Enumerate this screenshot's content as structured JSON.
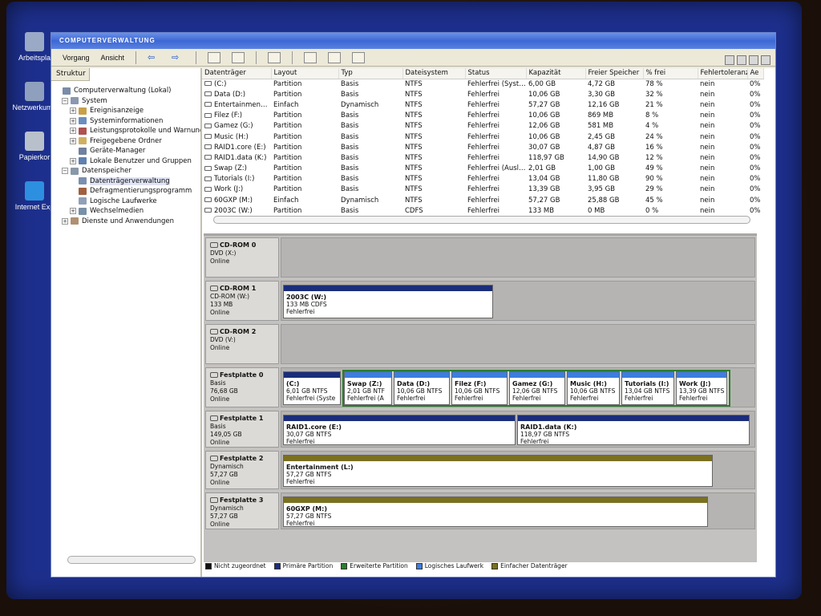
{
  "colors": {
    "primary": "#1a2d7a",
    "extended": "#2e7d2e",
    "logical": "#3c7ee0",
    "simple": "#7a7020",
    "unallocated": "#111111"
  },
  "desktop": {
    "icons": [
      {
        "label": "Arbeitspla",
        "icon": "my-computer-icon"
      },
      {
        "label": "Netzwerkumg",
        "icon": "network-icon"
      },
      {
        "label": "Papierkor",
        "icon": "recycle-bin-icon"
      },
      {
        "label": "Internet Exp",
        "icon": "internet-explorer-icon"
      }
    ]
  },
  "window": {
    "title": "COMPUTERVERWALTUNG",
    "menu": {
      "action": "Vorgang",
      "view": "Ansicht"
    }
  },
  "tree": {
    "tab": "Struktur",
    "items": [
      {
        "label": "Computerverwaltung (Lokal)",
        "level": 0,
        "toggle": "",
        "icon": "computer-mgmt-icon"
      },
      {
        "label": "System",
        "level": 1,
        "toggle": "-",
        "icon": "system-tools-icon"
      },
      {
        "label": "Ereignisanzeige",
        "level": 2,
        "toggle": "+",
        "icon": "event-viewer-icon"
      },
      {
        "label": "Systeminformationen",
        "level": 2,
        "toggle": "+",
        "icon": "system-info-icon"
      },
      {
        "label": "Leistungsprotokolle und Warnung",
        "level": 2,
        "toggle": "+",
        "icon": "performance-logs-icon"
      },
      {
        "label": "Freigegebene Ordner",
        "level": 2,
        "toggle": "+",
        "icon": "shared-folders-icon"
      },
      {
        "label": "Geräte-Manager",
        "level": 2,
        "toggle": "",
        "icon": "device-manager-icon"
      },
      {
        "label": "Lokale Benutzer und Gruppen",
        "level": 2,
        "toggle": "+",
        "icon": "users-groups-icon"
      },
      {
        "label": "Datenspeicher",
        "level": 1,
        "toggle": "-",
        "icon": "storage-icon"
      },
      {
        "label": "Datenträgerverwaltung",
        "level": 2,
        "toggle": "",
        "icon": "disk-management-icon",
        "selected": true
      },
      {
        "label": "Defragmentierungsprogramm",
        "level": 2,
        "toggle": "",
        "icon": "defrag-icon"
      },
      {
        "label": "Logische Laufwerke",
        "level": 2,
        "toggle": "",
        "icon": "logical-drives-icon"
      },
      {
        "label": "Wechselmedien",
        "level": 2,
        "toggle": "+",
        "icon": "removable-media-icon"
      },
      {
        "label": "Dienste und Anwendungen",
        "level": 1,
        "toggle": "+",
        "icon": "services-icon"
      }
    ]
  },
  "volumes": {
    "columns": [
      "Datenträger",
      "Layout",
      "Typ",
      "Dateisystem",
      "Status",
      "Kapazität",
      "Freier Speicher",
      "% frei",
      "Fehlertoleranz",
      "Ae"
    ],
    "rows": [
      [
        "(C:)",
        "Partition",
        "Basis",
        "NTFS",
        "Fehlerfrei (Syst…",
        "6,00 GB",
        "4,72 GB",
        "78 %",
        "nein",
        "0%"
      ],
      [
        "Data (D:)",
        "Partition",
        "Basis",
        "NTFS",
        "Fehlerfrei",
        "10,06 GB",
        "3,30 GB",
        "32 %",
        "nein",
        "0%"
      ],
      [
        "Entertainmen…",
        "Einfach",
        "Dynamisch",
        "NTFS",
        "Fehlerfrei",
        "57,27 GB",
        "12,16 GB",
        "21 %",
        "nein",
        "0%"
      ],
      [
        "Filez (F:)",
        "Partition",
        "Basis",
        "NTFS",
        "Fehlerfrei",
        "10,06 GB",
        "869 MB",
        "8 %",
        "nein",
        "0%"
      ],
      [
        "Gamez (G:)",
        "Partition",
        "Basis",
        "NTFS",
        "Fehlerfrei",
        "12,06 GB",
        "581 MB",
        "4 %",
        "nein",
        "0%"
      ],
      [
        "Music (H:)",
        "Partition",
        "Basis",
        "NTFS",
        "Fehlerfrei",
        "10,06 GB",
        "2,45 GB",
        "24 %",
        "nein",
        "0%"
      ],
      [
        "RAID1.core (E:)",
        "Partition",
        "Basis",
        "NTFS",
        "Fehlerfrei",
        "30,07 GB",
        "4,87 GB",
        "16 %",
        "nein",
        "0%"
      ],
      [
        "RAID1.data (K:)",
        "Partition",
        "Basis",
        "NTFS",
        "Fehlerfrei",
        "118,97 GB",
        "14,90 GB",
        "12 %",
        "nein",
        "0%"
      ],
      [
        "Swap (Z:)",
        "Partition",
        "Basis",
        "NTFS",
        "Fehlerfrei (Ausl…",
        "2,01 GB",
        "1,00 GB",
        "49 %",
        "nein",
        "0%"
      ],
      [
        "Tutorials (I:)",
        "Partition",
        "Basis",
        "NTFS",
        "Fehlerfrei",
        "13,04 GB",
        "11,80 GB",
        "90 %",
        "nein",
        "0%"
      ],
      [
        "Work (J:)",
        "Partition",
        "Basis",
        "NTFS",
        "Fehlerfrei",
        "13,39 GB",
        "3,95 GB",
        "29 %",
        "nein",
        "0%"
      ],
      [
        "60GXP (M:)",
        "Einfach",
        "Dynamisch",
        "NTFS",
        "Fehlerfrei",
        "57,27 GB",
        "25,88 GB",
        "45 %",
        "nein",
        "0%"
      ],
      [
        "2003C (W:)",
        "Partition",
        "Basis",
        "CDFS",
        "Fehlerfrei",
        "133 MB",
        "0 MB",
        "0 %",
        "nein",
        "0%"
      ]
    ]
  },
  "disks": [
    {
      "name": "CD-ROM 0",
      "l1": "DVD (X:)",
      "l2": "",
      "l3": "Online",
      "partitions": []
    },
    {
      "name": "CD-ROM 1",
      "l1": "CD-ROM (W:)",
      "l2": "133 MB",
      "l3": "Online",
      "partitions": [
        {
          "name": "2003C (W:)",
          "info": "133 MB CDFS",
          "status": "Fehlerfrei",
          "kind": "primary"
        }
      ]
    },
    {
      "name": "CD-ROM 2",
      "l1": "DVD (V:)",
      "l2": "",
      "l3": "Online",
      "partitions": []
    },
    {
      "name": "Festplatte 0",
      "l1": "Basis",
      "l2": "76,68 GB",
      "l3": "Online",
      "partitions": [
        {
          "name": "(C:)",
          "info": "6,01 GB NTFS",
          "status": "Fehlerfrei (Syste",
          "kind": "primary"
        },
        {
          "name": "Swap (Z:)",
          "info": "2,01 GB NTF",
          "status": "Fehlerfrei (A",
          "kind": "logical"
        },
        {
          "name": "Data (D:)",
          "info": "10,06 GB NTFS",
          "status": "Fehlerfrei",
          "kind": "logical"
        },
        {
          "name": "Filez (F:)",
          "info": "10,06 GB NTFS",
          "status": "Fehlerfrei",
          "kind": "logical"
        },
        {
          "name": "Gamez (G:)",
          "info": "12,06 GB NTFS",
          "status": "Fehlerfrei",
          "kind": "logical"
        },
        {
          "name": "Music (H:)",
          "info": "10,06 GB NTFS",
          "status": "Fehlerfrei",
          "kind": "logical"
        },
        {
          "name": "Tutorials (I:)",
          "info": "13,04 GB NTFS",
          "status": "Fehlerfrei",
          "kind": "logical"
        },
        {
          "name": "Work (J:)",
          "info": "13,39 GB NTFS",
          "status": "Fehlerfrei",
          "kind": "logical"
        }
      ]
    },
    {
      "name": "Festplatte 1",
      "l1": "Basis",
      "l2": "149,05 GB",
      "l3": "Online",
      "partitions": [
        {
          "name": "RAID1.core (E:)",
          "info": "30,07 GB NTFS",
          "status": "Fehlerfrei",
          "kind": "primary"
        },
        {
          "name": "RAID1.data (K:)",
          "info": "118,97 GB NTFS",
          "status": "Fehlerfrei",
          "kind": "primary"
        }
      ]
    },
    {
      "name": "Festplatte 2",
      "l1": "Dynamisch",
      "l2": "57,27 GB",
      "l3": "Online",
      "partitions": [
        {
          "name": "Entertainment (L:)",
          "info": "57,27 GB NTFS",
          "status": "Fehlerfrei",
          "kind": "simple"
        }
      ]
    },
    {
      "name": "Festplatte 3",
      "l1": "Dynamisch",
      "l2": "57,27 GB",
      "l3": "Online",
      "partitions": [
        {
          "name": "60GXP (M:)",
          "info": "57,27 GB NTFS",
          "status": "Fehlerfrei",
          "kind": "simple"
        }
      ]
    }
  ],
  "legend": [
    {
      "label": "Nicht zugeordnet",
      "kind": "unallocated"
    },
    {
      "label": "Primäre Partition",
      "kind": "primary"
    },
    {
      "label": "Erweiterte Partition",
      "kind": "extended"
    },
    {
      "label": "Logisches Laufwerk",
      "kind": "logical"
    },
    {
      "label": "Einfacher Datenträger",
      "kind": "simple"
    }
  ]
}
